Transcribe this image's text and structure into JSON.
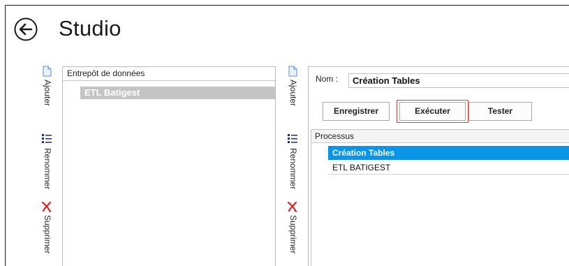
{
  "header": {
    "title": "Studio",
    "back_icon": "back-arrow-icon"
  },
  "left_toolbar": {
    "items": [
      {
        "label": "Ajouter",
        "icon": "document-icon"
      },
      {
        "label": "Renommer",
        "icon": "list-icon"
      },
      {
        "label": "Supprimer",
        "icon": "delete-x-icon"
      }
    ]
  },
  "left_panel": {
    "header": "Entrepôt de données",
    "items": [
      {
        "label": "ETL Batigest",
        "selected": true
      }
    ]
  },
  "right_toolbar": {
    "items": [
      {
        "label": "Ajouter",
        "icon": "document-icon"
      },
      {
        "label": "Renommer",
        "icon": "list-icon"
      },
      {
        "label": "Supprimer",
        "icon": "delete-x-icon"
      }
    ]
  },
  "detail": {
    "name_label": "Nom :",
    "name_value": "Création Tables",
    "buttons": {
      "save": "Enregistrer",
      "run": "Exécuter",
      "test": "Tester"
    },
    "grid": {
      "header": "Processus",
      "rows": [
        {
          "label": "Création Tables",
          "selected": true
        },
        {
          "label": "ETL BATIGEST",
          "selected": false
        }
      ]
    }
  },
  "colors": {
    "selection_blue": "#0a95e8",
    "selection_gray": "#c4c4c4",
    "highlight_red": "#d6403e",
    "delete_red": "#d82424"
  }
}
